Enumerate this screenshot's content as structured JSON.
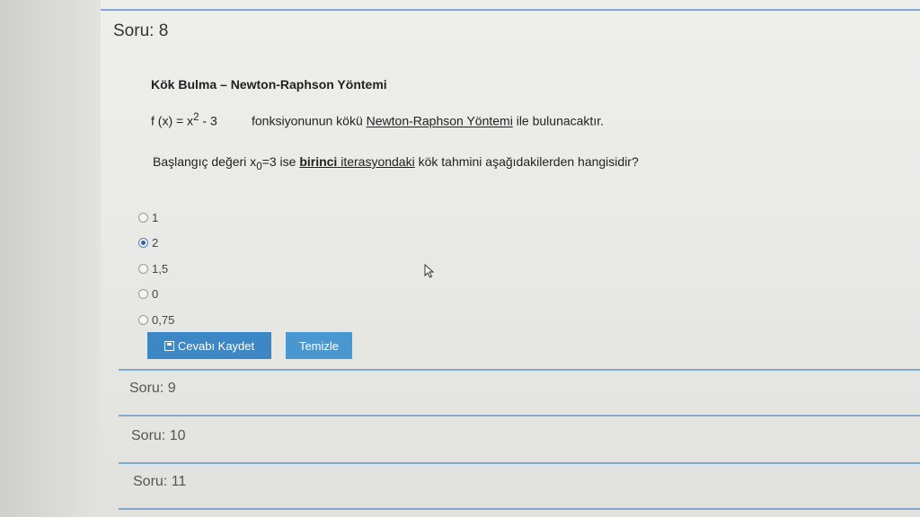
{
  "question": {
    "title": "Soru: 8",
    "heading": "Kök Bulma – Newton-Raphson Yöntemi",
    "function_prefix": "f (x) = x",
    "function_exp": "2",
    "function_suffix": " - 3",
    "line1_text": "fonksiyonunun kökü ",
    "line1_link": "Newton-Raphson Yöntemi",
    "line1_end": " ile bulunacaktır.",
    "line2_start": "Başlangıç değeri x",
    "line2_sub": "0",
    "line2_mid": "=3  ise ",
    "line2_bold": "birinci",
    "line2_under": " iterasyondaki",
    "line2_end": " kök tahmini aşağıdakilerden  hangisidir?"
  },
  "options": [
    {
      "label": "1",
      "selected": false
    },
    {
      "label": "2",
      "selected": true
    },
    {
      "label": "1,5",
      "selected": false
    },
    {
      "label": "0",
      "selected": false
    },
    {
      "label": "0,75",
      "selected": false
    }
  ],
  "buttons": {
    "save_label": "Cevabı Kaydet",
    "clear_label": "Temizle"
  },
  "next_questions": [
    "Soru: 9",
    "Soru: 10",
    "Soru: 11"
  ],
  "colors": {
    "accent": "#3d87c4",
    "separator": "#7fa9cf"
  }
}
